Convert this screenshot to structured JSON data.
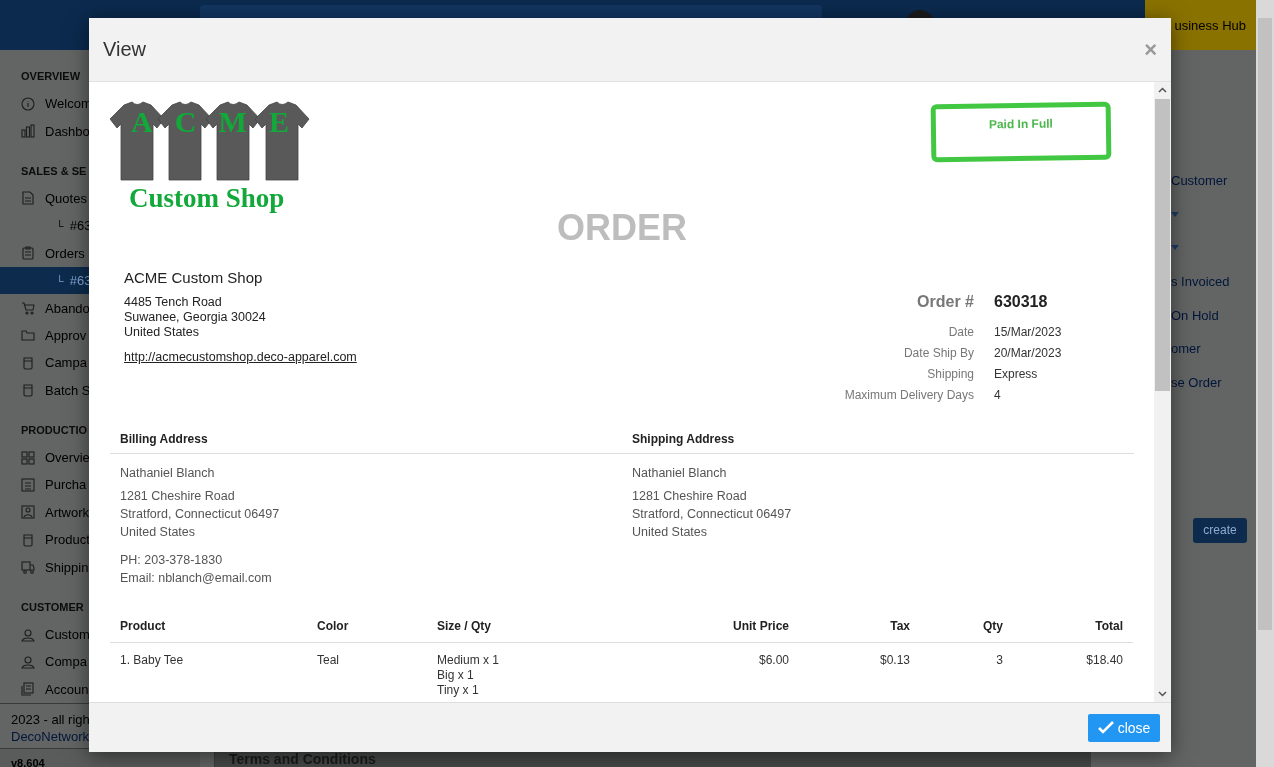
{
  "top_bar": {
    "hub_label": "usiness Hub"
  },
  "sidebar": {
    "sections": [
      {
        "heading": "OVERVIEW",
        "items": [
          {
            "kind": "link",
            "label": "Welcom",
            "selected": false
          },
          {
            "kind": "link",
            "label": "Dashbo",
            "selected": false
          }
        ]
      },
      {
        "heading": "SALES & SE",
        "items": [
          {
            "kind": "link",
            "label": "Quotes",
            "selected": false
          },
          {
            "kind": "sub",
            "marker": "└",
            "label": "#63",
            "selected": false
          },
          {
            "kind": "link",
            "label": "Orders",
            "selected": false
          },
          {
            "kind": "sub",
            "marker": "└",
            "label": "#63",
            "selected": true
          },
          {
            "kind": "link",
            "label": "Abando",
            "selected": false
          },
          {
            "kind": "link",
            "label": "Approv",
            "selected": false
          },
          {
            "kind": "link",
            "label": "Campa",
            "selected": false
          },
          {
            "kind": "link",
            "label": "Batch S",
            "selected": false
          }
        ]
      },
      {
        "heading": "PRODUCTIO",
        "items": [
          {
            "kind": "link",
            "label": "Overvie",
            "selected": false
          },
          {
            "kind": "link",
            "label": "Purcha",
            "selected": false
          },
          {
            "kind": "link",
            "label": "Artwork",
            "selected": false
          },
          {
            "kind": "link",
            "label": "Product",
            "selected": false
          },
          {
            "kind": "link",
            "label": "Shippin",
            "selected": false
          }
        ]
      },
      {
        "heading": "CUSTOMER",
        "items": [
          {
            "kind": "link",
            "label": "Custom",
            "selected": false
          },
          {
            "kind": "link",
            "label": "Compa",
            "selected": false
          },
          {
            "kind": "link",
            "label": "Accoun",
            "selected": false
          }
        ]
      }
    ],
    "copyright": "2023 - all righ",
    "company_link": "DecoNetwork",
    "version": "v8.604"
  },
  "right_panel": {
    "links": [
      {
        "kind": "text",
        "label": "Customer"
      },
      {
        "kind": "caret"
      },
      {
        "kind": "caret"
      },
      {
        "kind": "text",
        "label": "s Invoiced"
      },
      {
        "kind": "text",
        "label": "On Hold"
      },
      {
        "kind": "text",
        "label": "omer"
      },
      {
        "kind": "text",
        "label": "se Order"
      }
    ],
    "create_button": "create"
  },
  "background_panel": {
    "heading": "Terms and Conditions"
  },
  "modal": {
    "title": "View",
    "close_icon": "×",
    "logo": {
      "letters": [
        "A",
        "C",
        "M",
        "E"
      ],
      "name": "Custom Shop"
    },
    "stamp": "Paid In Full",
    "heading": "ORDER",
    "company": {
      "name": "ACME Custom Shop",
      "address": [
        "4485 Tench Road",
        "Suwanee, Georgia 30024",
        "United States"
      ],
      "website": "http://acmecustomshop.deco-apparel.com"
    },
    "order": {
      "number_label": "Order #",
      "number": "630318",
      "details": [
        {
          "label": "Date",
          "value": "15/Mar/2023"
        },
        {
          "label": "Date Ship By",
          "value": "20/Mar/2023"
        },
        {
          "label": "Shipping",
          "value": "Express"
        },
        {
          "label": "Maximum Delivery Days",
          "value": "4"
        }
      ]
    },
    "addresses": [
      {
        "heading": "Billing Address",
        "name": "Nathaniel Blanch",
        "lines": [
          "1281 Cheshire Road",
          "Stratford, Connecticut 06497",
          "United States"
        ],
        "contact": [
          "PH: 203-378-1830",
          "Email: nblanch@email.com"
        ]
      },
      {
        "heading": "Shipping Address",
        "name": "Nathaniel Blanch",
        "lines": [
          "1281 Cheshire Road",
          "Stratford, Connecticut 06497",
          "United States"
        ]
      }
    ],
    "products": {
      "columns": [
        "Product",
        "Color",
        "Size / Qty",
        "Unit Price",
        "Tax",
        "Qty",
        "Total"
      ],
      "rows": [
        {
          "cells": [
            "1. Baby Tee",
            "Teal",
            [
              "Medium x 1",
              "Big x 1",
              "Tiny x 1"
            ],
            "$6.00",
            "$0.13",
            "3",
            "$18.40"
          ]
        }
      ]
    },
    "close_button": "close"
  }
}
